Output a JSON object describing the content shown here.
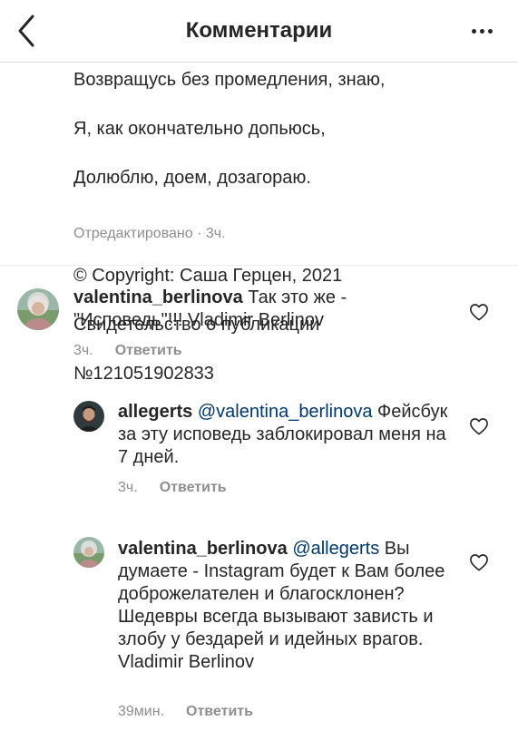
{
  "header": {
    "title": "Комментарии"
  },
  "caption": {
    "cut_line": "Возвращусь без промедления, знаю,",
    "lines": [
      "Я, как окончательно допьюсь,",
      "Долюблю, доем, дозагораю.",
      "",
      "© Copyright: Саша Герцен, 2021",
      "Свидетельство о публикации",
      "№121051902833"
    ],
    "edited": "Отредактировано",
    "time": "3ч."
  },
  "comments": [
    {
      "username": "valentina_berlinova",
      "mention": "",
      "text": "Так это же - \"Исповедь\"!!! Vladimir Berlinov",
      "time": "3ч.",
      "reply_label": "Ответить"
    },
    {
      "username": "allegerts",
      "mention": "@valentina_berlinova",
      "text": "Фейсбук за эту исповедь заблокировал меня на 7 дней.",
      "time": "3ч.",
      "reply_label": "Ответить"
    },
    {
      "username": "valentina_berlinova",
      "mention": "@allegerts",
      "text": "Вы думаете - Instagram будет к Вам более доброжелателен и благосклонен? Шедевры всегда вызывают зависть и злобу у бездарей и идейных врагов. Vladimir Berlinov",
      "time": "39мин.",
      "reply_label": "Ответить"
    }
  ]
}
